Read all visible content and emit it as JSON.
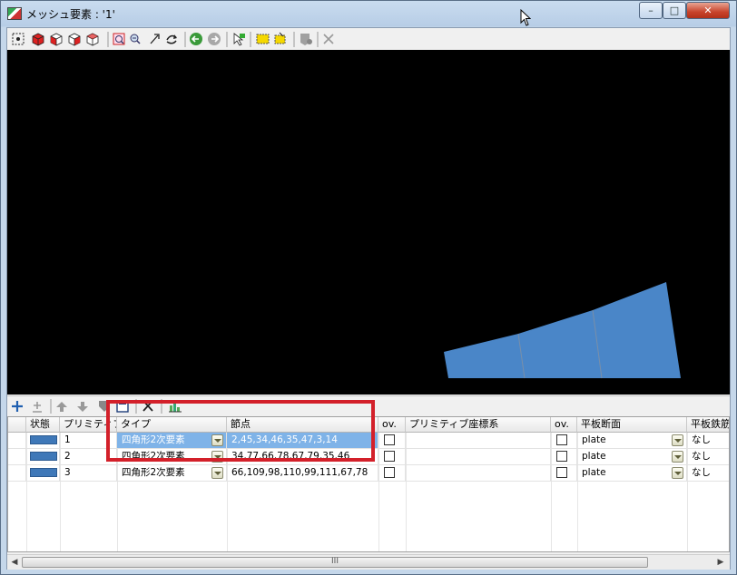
{
  "window": {
    "title": "メッシュ要素 : '1'",
    "minimize": "–",
    "maximize": "□",
    "close": "✕"
  },
  "toolbar": {
    "icons": [
      "select-all-icon",
      "box-view-icon",
      "box-front-icon",
      "box-side-icon",
      "wireframe-box-icon",
      "zoom-window-icon",
      "zoom-out-icon",
      "pan-arrow-icon",
      "rotate-icon",
      "back-icon",
      "forward-icon",
      "pick-icon",
      "select-rect-icon",
      "select-lasso-icon",
      "filter-icon",
      "clear-icon"
    ]
  },
  "grid_toolbar": {
    "icons": [
      "add-row-icon",
      "insert-row-icon",
      "move-up-icon",
      "move-down-icon",
      "copy-icon",
      "save-icon",
      "delete-icon",
      "chart-icon"
    ]
  },
  "table": {
    "headers": [
      "状態",
      "プリミティブ",
      "タイプ",
      "節点",
      "ov.",
      "プリミティブ座標系",
      "ov.",
      "平板断面",
      "平板鉄筋"
    ],
    "rows": [
      {
        "id": "1",
        "type": "四角形2次要素",
        "nodes": "2,45,34,46,35,47,3,14",
        "section": "plate",
        "rebar": "なし"
      },
      {
        "id": "2",
        "type": "四角形2次要素",
        "nodes": "34,77,66,78,67,79,35,46",
        "section": "plate",
        "rebar": "なし"
      },
      {
        "id": "3",
        "type": "四角形2次要素",
        "nodes": "66,109,98,110,99,111,67,78",
        "section": "plate",
        "rebar": "なし"
      }
    ],
    "status_color": "#3f78b8",
    "selection_color": "#7fb3e8"
  },
  "mesh": {
    "color": "#4a86c8",
    "edge_color": "#7a8fa8"
  },
  "scrollbar": {
    "thumb_grip": "III"
  },
  "highlight_color": "#d3202a"
}
